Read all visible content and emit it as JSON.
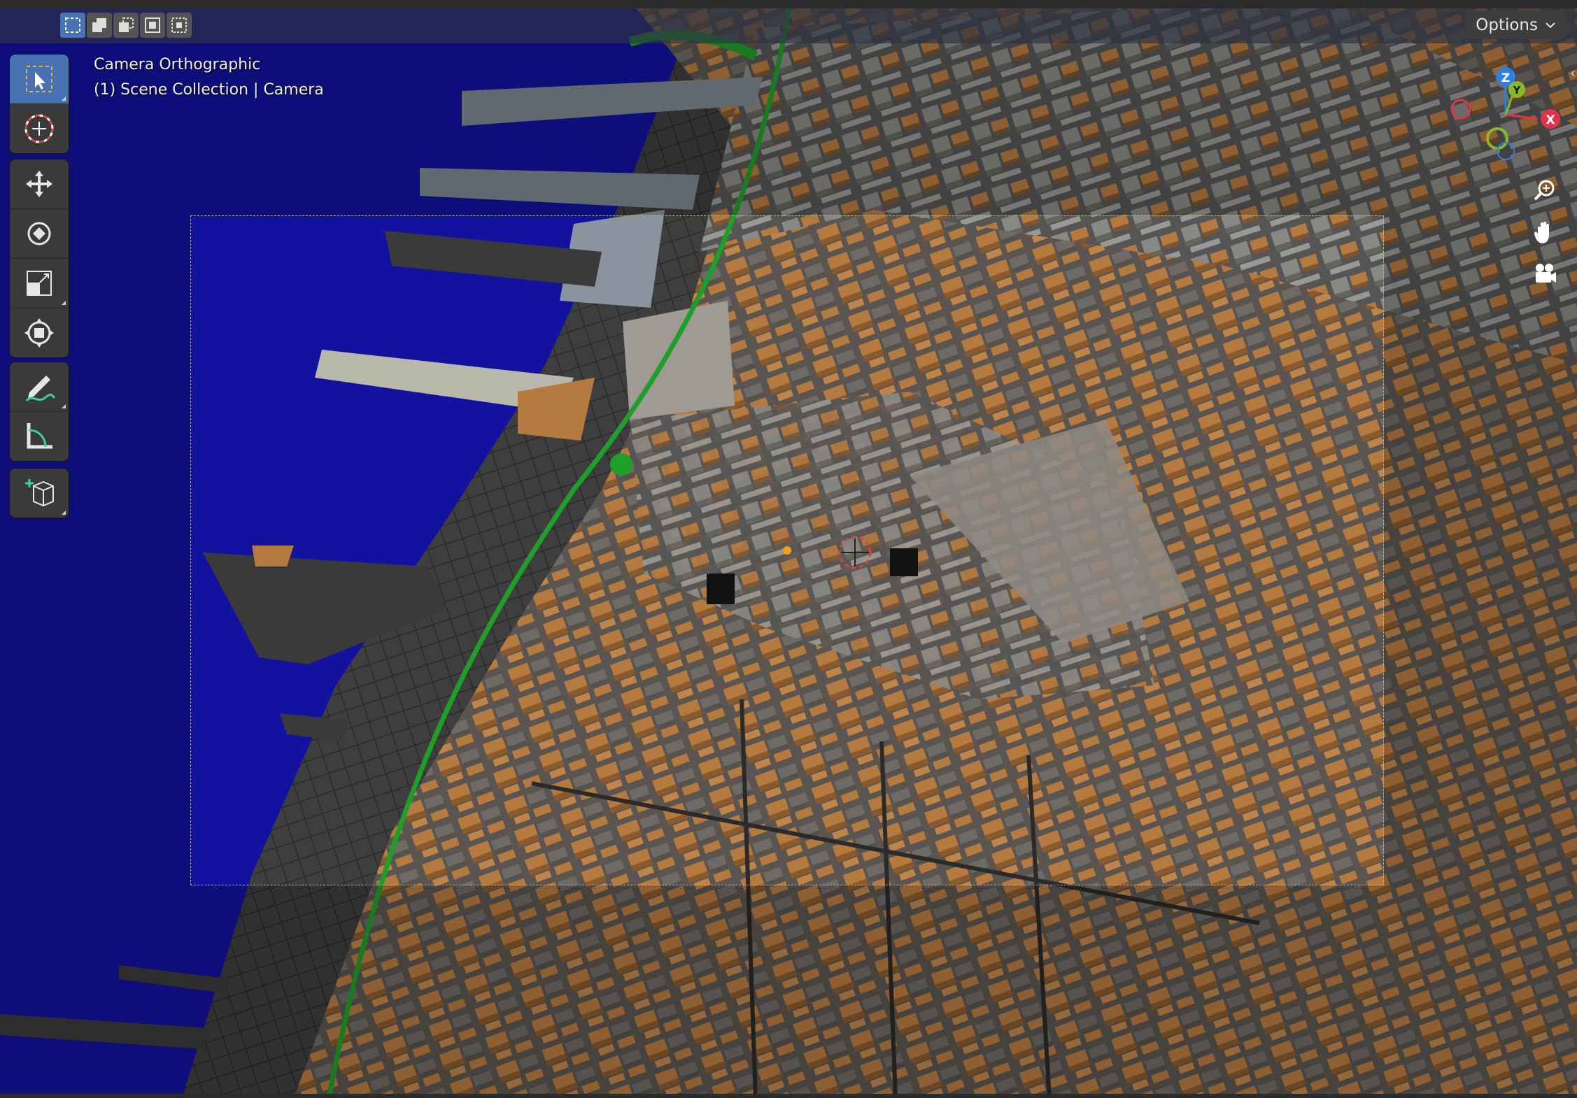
{
  "viewport": {
    "view_label": "Camera Orthographic",
    "collection_label": "(1) Scene Collection | Camera"
  },
  "header": {
    "selection_modes": [
      {
        "icon": "select-new-icon",
        "active": true
      },
      {
        "icon": "select-extend-icon",
        "active": false
      },
      {
        "icon": "select-subtract-icon",
        "active": false
      },
      {
        "icon": "select-invert-icon",
        "active": false
      },
      {
        "icon": "select-intersect-icon",
        "active": false
      }
    ],
    "options_label": "Options"
  },
  "toolbar": {
    "tools": [
      {
        "icon": "select-box-icon",
        "active": true
      },
      {
        "icon": "cursor-icon",
        "active": false
      },
      {
        "icon": "move-icon",
        "active": false
      },
      {
        "icon": "rotate-icon",
        "active": false
      },
      {
        "icon": "scale-icon",
        "active": false
      },
      {
        "icon": "transform-icon",
        "active": false
      },
      {
        "icon": "annotate-icon",
        "active": false
      },
      {
        "icon": "measure-icon",
        "active": false
      },
      {
        "icon": "add-cube-icon",
        "active": false
      }
    ]
  },
  "gizmo": {
    "axes": [
      {
        "label": "Z",
        "color": "#2f7fe0"
      },
      {
        "label": "Y",
        "color": "#8ab82c"
      },
      {
        "label": "X",
        "color": "#e0344a"
      }
    ],
    "nav_icons": [
      "zoom-icon",
      "pan-hand-icon",
      "camera-view-icon"
    ]
  },
  "colors": {
    "water": "#12129e",
    "building_orange": "#b57a40",
    "building_gray": "#7a7a78",
    "street": "#3a3a3a",
    "park": "#1f9e2a",
    "accent": "#4772b3"
  }
}
